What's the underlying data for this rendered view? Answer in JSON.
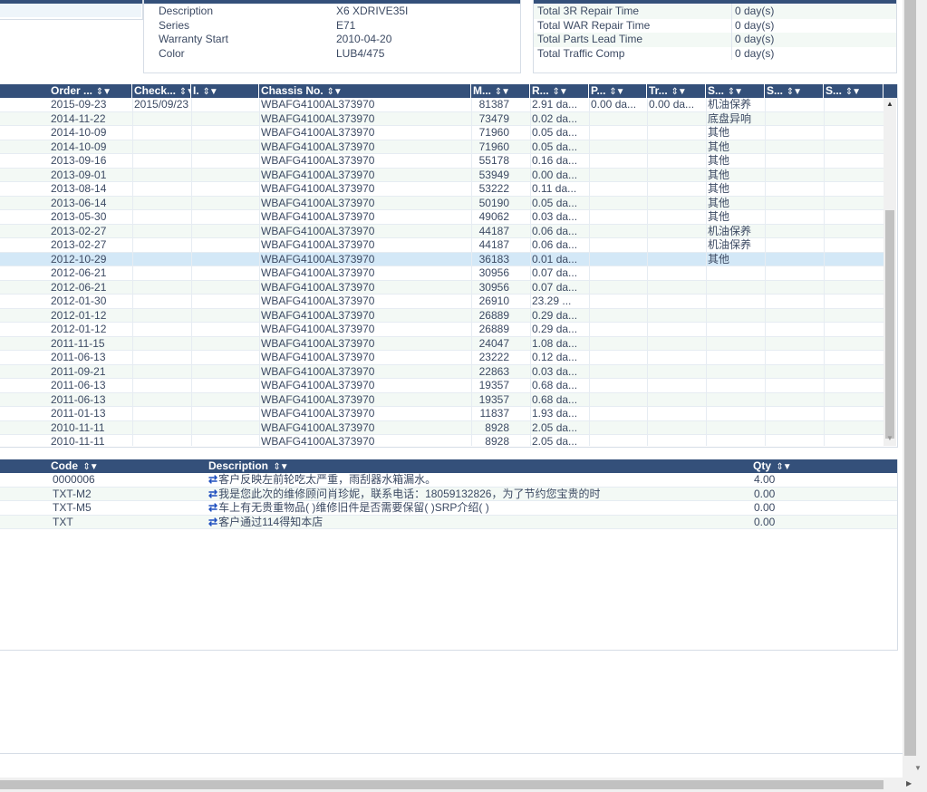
{
  "vehicle": {
    "fields": [
      {
        "label": "Description",
        "value": "X6 XDRIVE35I"
      },
      {
        "label": "Series",
        "value": "E71"
      },
      {
        "label": "Warranty Start",
        "value": "2010-04-20"
      },
      {
        "label": "Color",
        "value": "LUB4/475"
      }
    ]
  },
  "repair_summary": {
    "fields": [
      {
        "label": "Total 3R Repair Time",
        "value": "0 day(s)"
      },
      {
        "label": "Total WAR Repair Time",
        "value": "0 day(s)"
      },
      {
        "label": "Total Parts Lead Time",
        "value": "0 day(s)"
      },
      {
        "label": "Total Traffic Comp",
        "value": "0 day(s)"
      }
    ]
  },
  "orders": {
    "columns": [
      "Order ...",
      "Check...",
      "I.",
      "Chassis No.",
      "M...",
      "R...",
      "P...",
      "Tr...",
      "S...",
      "S...",
      "S..."
    ],
    "sort_icon": "⇕",
    "filter_icon": "▼",
    "rows": [
      [
        "2015-09-23",
        "2015/09/23",
        "",
        "WBAFG4100AL373970",
        "81387",
        "2.91 da...",
        "0.00 da...",
        "0.00 da...",
        "机油保养",
        "",
        ""
      ],
      [
        "2014-11-22",
        "",
        "",
        "WBAFG4100AL373970",
        "73479",
        "0.02 da...",
        "",
        "",
        "底盘异响",
        "",
        ""
      ],
      [
        "2014-10-09",
        "",
        "",
        "WBAFG4100AL373970",
        "71960",
        "0.05 da...",
        "",
        "",
        "其他",
        "",
        ""
      ],
      [
        "2014-10-09",
        "",
        "",
        "WBAFG4100AL373970",
        "71960",
        "0.05 da...",
        "",
        "",
        "其他",
        "",
        ""
      ],
      [
        "2013-09-16",
        "",
        "",
        "WBAFG4100AL373970",
        "55178",
        "0.16 da...",
        "",
        "",
        "其他",
        "",
        ""
      ],
      [
        "2013-09-01",
        "",
        "",
        "WBAFG4100AL373970",
        "53949",
        "0.00 da...",
        "",
        "",
        "其他",
        "",
        ""
      ],
      [
        "2013-08-14",
        "",
        "",
        "WBAFG4100AL373970",
        "53222",
        "0.11 da...",
        "",
        "",
        "其他",
        "",
        ""
      ],
      [
        "2013-06-14",
        "",
        "",
        "WBAFG4100AL373970",
        "50190",
        "0.05 da...",
        "",
        "",
        "其他",
        "",
        ""
      ],
      [
        "2013-05-30",
        "",
        "",
        "WBAFG4100AL373970",
        "49062",
        "0.03 da...",
        "",
        "",
        "其他",
        "",
        ""
      ],
      [
        "2013-02-27",
        "",
        "",
        "WBAFG4100AL373970",
        "44187",
        "0.06 da...",
        "",
        "",
        "机油保养",
        "",
        ""
      ],
      [
        "2013-02-27",
        "",
        "",
        "WBAFG4100AL373970",
        "44187",
        "0.06 da...",
        "",
        "",
        "机油保养",
        "",
        ""
      ],
      [
        "2012-10-29",
        "",
        "",
        "WBAFG4100AL373970",
        "36183",
        "0.01 da...",
        "",
        "",
        "其他",
        "",
        ""
      ],
      [
        "2012-06-21",
        "",
        "",
        "WBAFG4100AL373970",
        "30956",
        "0.07 da...",
        "",
        "",
        "",
        "",
        ""
      ],
      [
        "2012-06-21",
        "",
        "",
        "WBAFG4100AL373970",
        "30956",
        "0.07 da...",
        "",
        "",
        "",
        "",
        ""
      ],
      [
        "2012-01-30",
        "",
        "",
        "WBAFG4100AL373970",
        "26910",
        "23.29 ...",
        "",
        "",
        "",
        "",
        ""
      ],
      [
        "2012-01-12",
        "",
        "",
        "WBAFG4100AL373970",
        "26889",
        "0.29 da...",
        "",
        "",
        "",
        "",
        ""
      ],
      [
        "2012-01-12",
        "",
        "",
        "WBAFG4100AL373970",
        "26889",
        "0.29 da...",
        "",
        "",
        "",
        "",
        ""
      ],
      [
        "2011-11-15",
        "",
        "",
        "WBAFG4100AL373970",
        "24047",
        "1.08 da...",
        "",
        "",
        "",
        "",
        ""
      ],
      [
        "2011-06-13",
        "",
        "",
        "WBAFG4100AL373970",
        "23222",
        "0.12 da...",
        "",
        "",
        "",
        "",
        ""
      ],
      [
        "2011-09-21",
        "",
        "",
        "WBAFG4100AL373970",
        "22863",
        "0.03 da...",
        "",
        "",
        "",
        "",
        ""
      ],
      [
        "2011-06-13",
        "",
        "",
        "WBAFG4100AL373970",
        "19357",
        "0.68 da...",
        "",
        "",
        "",
        "",
        ""
      ],
      [
        "2011-06-13",
        "",
        "",
        "WBAFG4100AL373970",
        "19357",
        "0.68 da...",
        "",
        "",
        "",
        "",
        ""
      ],
      [
        "2011-01-13",
        "",
        "",
        "WBAFG4100AL373970",
        "11837",
        "1.93 da...",
        "",
        "",
        "",
        "",
        ""
      ],
      [
        "2010-11-11",
        "",
        "",
        "WBAFG4100AL373970",
        "8928",
        "2.05 da...",
        "",
        "",
        "",
        "",
        ""
      ],
      [
        "2010-11-11",
        "",
        "",
        "WBAFG4100AL373970",
        "8928",
        "2.05 da...",
        "",
        "",
        "",
        "",
        ""
      ]
    ],
    "selected_row": 11
  },
  "details": {
    "columns": [
      "Code",
      "Description",
      "Qty"
    ],
    "swap_icon": "⇄",
    "rows": [
      {
        "code": "0000006",
        "desc": "客户反映左前轮吃太严重，雨刮器水箱漏水。",
        "qty": "4.00"
      },
      {
        "code": "TXT-M2",
        "desc": "我是您此次的维修顾问肖珍妮，联系电话：18059132826，为了节约您宝贵的时",
        "qty": "0.00"
      },
      {
        "code": "TXT-M5",
        "desc": "车上有无贵重物品( )维修旧件是否需要保留( )SRP介绍( )",
        "qty": "0.00"
      },
      {
        "code": "TXT",
        "desc": "客户通过114得知本店",
        "qty": "0.00"
      }
    ]
  },
  "colors": {
    "header": "#34507a",
    "alt_row": "#f3f9f5",
    "selected_row": "#d3e8f7"
  }
}
